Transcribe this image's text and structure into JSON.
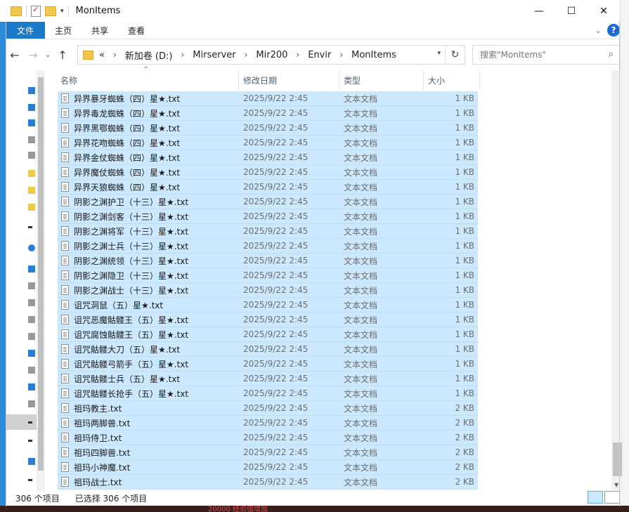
{
  "window": {
    "title": "MonItems",
    "controls": {
      "minimize": "—",
      "maximize": "☐",
      "close": "✕"
    }
  },
  "quick_access_toolbar": {
    "icons": [
      "folder-icon",
      "properties-icon",
      "new-folder-icon",
      "customize-dropdown-icon"
    ]
  },
  "ribbon": {
    "tabs": [
      {
        "label": "文件"
      },
      {
        "label": "主页"
      },
      {
        "label": "共享"
      },
      {
        "label": "查看"
      }
    ],
    "expand_icon": "chevron-down-icon",
    "help_label": "?"
  },
  "navigation": {
    "back_icon": "←",
    "forward_icon": "→",
    "recent_icon": "⌄",
    "up_icon": "↑"
  },
  "address_bar": {
    "overflow": "«",
    "crumbs": [
      "新加卷 (D:)",
      "Mirserver",
      "Mir200",
      "Envir",
      "MonItems"
    ],
    "separator": "›",
    "refresh_icon": "↻"
  },
  "search": {
    "placeholder": "搜索\"MonItems\"",
    "icon": "search-icon"
  },
  "columns": {
    "name": "名称",
    "date": "修改日期",
    "type": "类型",
    "size": "大小"
  },
  "files": [
    {
      "name": "异界暴牙蜘蛛（四）星★.txt",
      "date": "2025/9/22 2:45",
      "type": "文本文档",
      "size": "1 KB"
    },
    {
      "name": "异界毒龙蜘蛛（四）星★.txt",
      "date": "2025/9/22 2:45",
      "type": "文本文档",
      "size": "1 KB"
    },
    {
      "name": "异界黑鄂蜘蛛（四）星★.txt",
      "date": "2025/9/22 2:45",
      "type": "文本文档",
      "size": "1 KB"
    },
    {
      "name": "异界花吻蜘蛛（四）星★.txt",
      "date": "2025/9/22 2:45",
      "type": "文本文档",
      "size": "1 KB"
    },
    {
      "name": "异界金仗蜘蛛（四）星★.txt",
      "date": "2025/9/22 2:45",
      "type": "文本文档",
      "size": "1 KB"
    },
    {
      "name": "异界魔仗蜘蛛（四）星★.txt",
      "date": "2025/9/22 2:45",
      "type": "文本文档",
      "size": "1 KB"
    },
    {
      "name": "异界天狼蜘蛛（四）星★.txt",
      "date": "2025/9/22 2:45",
      "type": "文本文档",
      "size": "1 KB"
    },
    {
      "name": "阴影之渊护卫（十三）星★.txt",
      "date": "2025/9/22 2:45",
      "type": "文本文档",
      "size": "1 KB"
    },
    {
      "name": "阴影之渊剑客（十三）星★.txt",
      "date": "2025/9/22 2:45",
      "type": "文本文档",
      "size": "1 KB"
    },
    {
      "name": "阴影之渊将军（十三）星★.txt",
      "date": "2025/9/22 2:45",
      "type": "文本文档",
      "size": "1 KB"
    },
    {
      "name": "阴影之渊士兵（十三）星★.txt",
      "date": "2025/9/22 2:45",
      "type": "文本文档",
      "size": "1 KB"
    },
    {
      "name": "阴影之渊统领（十三）星★.txt",
      "date": "2025/9/22 2:45",
      "type": "文本文档",
      "size": "1 KB"
    },
    {
      "name": "阴影之渊隐卫（十三）星★.txt",
      "date": "2025/9/22 2:45",
      "type": "文本文档",
      "size": "1 KB"
    },
    {
      "name": "阴影之渊战士（十三）星★.txt",
      "date": "2025/9/22 2:45",
      "type": "文本文档",
      "size": "1 KB"
    },
    {
      "name": "诅咒洞鼠（五）星★.txt",
      "date": "2025/9/22 2:45",
      "type": "文本文档",
      "size": "1 KB"
    },
    {
      "name": "诅咒恶魔骷髅王（五）星★.txt",
      "date": "2025/9/22 2:45",
      "type": "文本文档",
      "size": "1 KB"
    },
    {
      "name": "诅咒腐蚀骷髅王（五）星★.txt",
      "date": "2025/9/22 2:45",
      "type": "文本文档",
      "size": "1 KB"
    },
    {
      "name": "诅咒骷髅大刀（五）星★.txt",
      "date": "2025/9/22 2:45",
      "type": "文本文档",
      "size": "1 KB"
    },
    {
      "name": "诅咒骷髅弓箭手（五）星★.txt",
      "date": "2025/9/22 2:45",
      "type": "文本文档",
      "size": "1 KB"
    },
    {
      "name": "诅咒骷髅士兵（五）星★.txt",
      "date": "2025/9/22 2:45",
      "type": "文本文档",
      "size": "1 KB"
    },
    {
      "name": "诅咒骷髅长抢手（五）星★.txt",
      "date": "2025/9/22 2:45",
      "type": "文本文档",
      "size": "1 KB"
    },
    {
      "name": "祖玛教主.txt",
      "date": "2025/9/22 2:45",
      "type": "文本文档",
      "size": "2 KB"
    },
    {
      "name": "祖玛两脚兽.txt",
      "date": "2025/9/22 2:45",
      "type": "文本文档",
      "size": "2 KB"
    },
    {
      "name": "祖玛侍卫.txt",
      "date": "2025/9/22 2:45",
      "type": "文本文档",
      "size": "2 KB"
    },
    {
      "name": "祖玛四脚兽.txt",
      "date": "2025/9/22 2:45",
      "type": "文本文档",
      "size": "2 KB"
    },
    {
      "name": "祖玛小神魔.txt",
      "date": "2025/9/22 2:45",
      "type": "文本文档",
      "size": "2 KB"
    },
    {
      "name": "祖玛战士.txt",
      "date": "2025/9/22 2:45",
      "type": "文本文档",
      "size": "2 KB"
    }
  ],
  "status": {
    "item_count": "306 个项目",
    "selected": "已选择 306 个项目"
  },
  "colors": {
    "accent": "#1979ca",
    "selection": "#cce8ff",
    "header_text": "#4c607a"
  },
  "background": {
    "bottom_text": "20000 经验值增加"
  }
}
